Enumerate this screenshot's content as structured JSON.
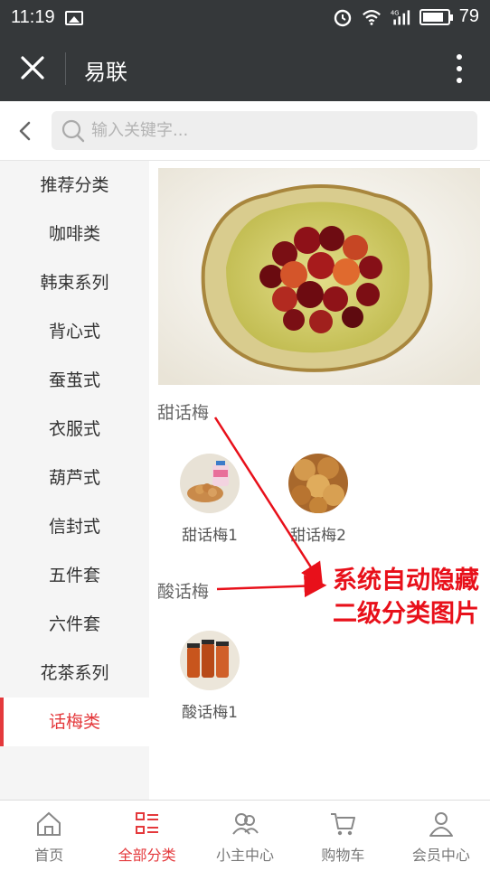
{
  "status_bar": {
    "time": "11:19",
    "battery": "79",
    "network": "4G"
  },
  "header": {
    "title": "易联"
  },
  "search": {
    "placeholder": "输入关键字..."
  },
  "sidebar": {
    "items": [
      {
        "label": "推荐分类"
      },
      {
        "label": "咖啡类"
      },
      {
        "label": "韩束系列"
      },
      {
        "label": "背心式"
      },
      {
        "label": "蚕茧式"
      },
      {
        "label": "衣服式"
      },
      {
        "label": "葫芦式"
      },
      {
        "label": "信封式"
      },
      {
        "label": "五件套"
      },
      {
        "label": "六件套"
      },
      {
        "label": "花茶系列"
      },
      {
        "label": "话梅类"
      }
    ],
    "active_index": 11
  },
  "content": {
    "sections": [
      {
        "title": "甜话梅",
        "items": [
          {
            "label": "甜话梅1"
          },
          {
            "label": "甜话梅2"
          }
        ]
      },
      {
        "title": "酸话梅",
        "items": [
          {
            "label": "酸话梅1"
          }
        ]
      }
    ]
  },
  "annotation": {
    "text": "系统自动隐藏二级分类图片"
  },
  "bottom_nav": {
    "items": [
      {
        "label": "首页",
        "icon": "home-icon"
      },
      {
        "label": "全部分类",
        "icon": "category-icon"
      },
      {
        "label": "小主中心",
        "icon": "community-icon"
      },
      {
        "label": "购物车",
        "icon": "cart-icon"
      },
      {
        "label": "会员中心",
        "icon": "user-icon"
      }
    ],
    "active_index": 1
  },
  "colors": {
    "accent": "#e4393c",
    "header_bg": "#35383a",
    "annotation": "#e8101a"
  }
}
